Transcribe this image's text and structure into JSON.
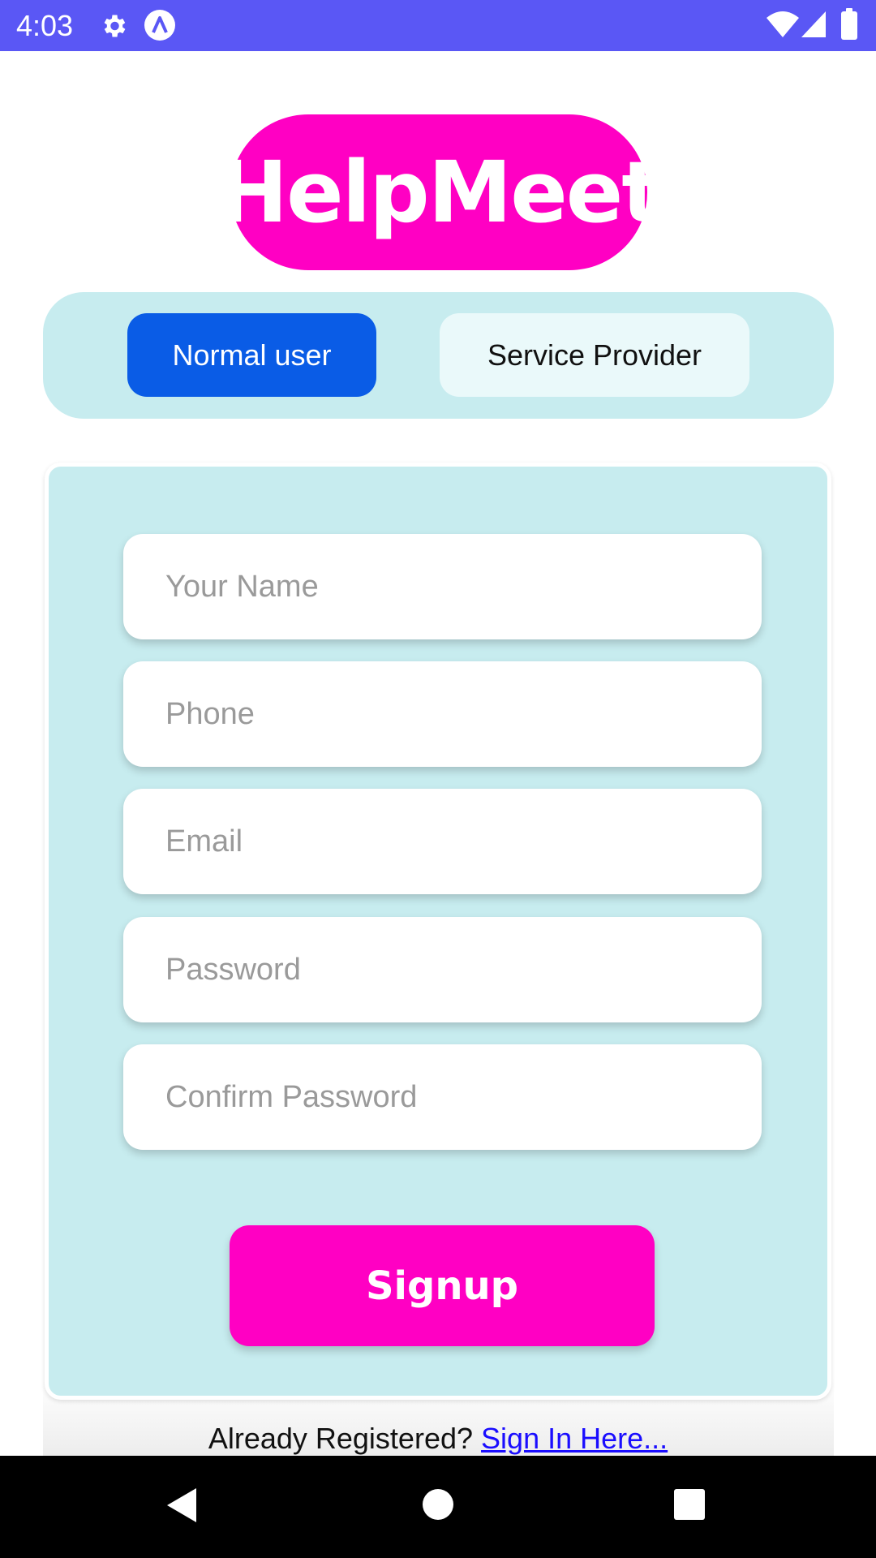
{
  "status_bar": {
    "time": "4:03",
    "icons": [
      "gear-icon",
      "app-a-icon",
      "wifi-icon",
      "signal-icon",
      "battery-icon"
    ]
  },
  "logo": {
    "text": "HelpMeet"
  },
  "role_toggle": {
    "options": [
      {
        "label": "Normal user",
        "selected": true
      },
      {
        "label": "Service Provider",
        "selected": false
      }
    ]
  },
  "form": {
    "fields": [
      {
        "placeholder": "Your Name",
        "value": ""
      },
      {
        "placeholder": "Phone",
        "value": ""
      },
      {
        "placeholder": "Email",
        "value": ""
      },
      {
        "placeholder": "Password",
        "value": ""
      },
      {
        "placeholder": "Confirm Password",
        "value": ""
      }
    ],
    "submit_label": "Signup"
  },
  "footer": {
    "prompt": "Already Registered?",
    "link_label": "Sign In Here..."
  },
  "nav_bar": {
    "icons": [
      "back-icon",
      "home-icon",
      "recents-icon"
    ]
  },
  "colors": {
    "status_bar": "#5a57f5",
    "brand_pink": "#ff00c3",
    "selected_blue": "#0a5ce6",
    "panel_teal": "#c7ecef",
    "link_blue": "#1a0dff"
  }
}
